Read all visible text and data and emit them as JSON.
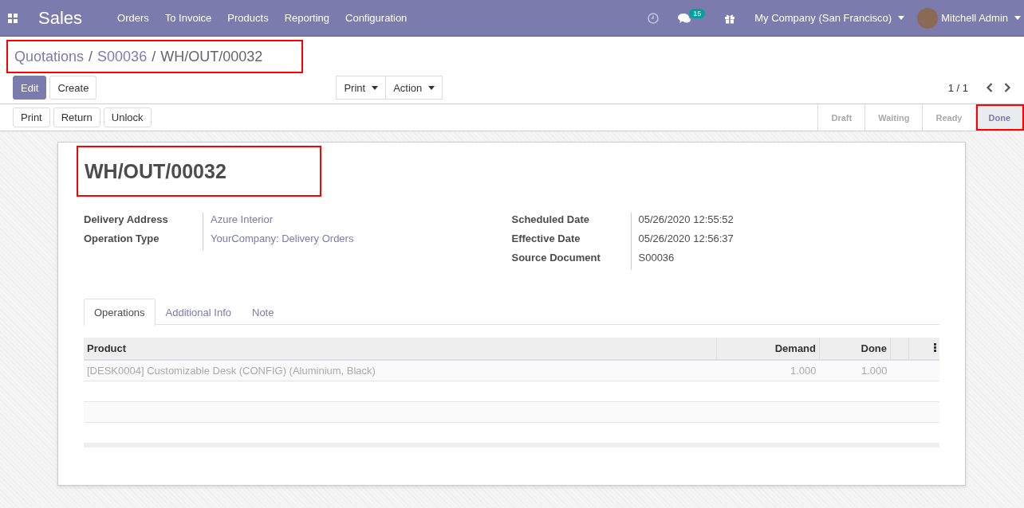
{
  "navbar": {
    "app_name": "Sales",
    "menus": [
      "Orders",
      "To Invoice",
      "Products",
      "Reporting",
      "Configuration"
    ],
    "message_count": "15",
    "company": "My Company (San Francisco)",
    "user": "Mitchell Admin"
  },
  "breadcrumb": {
    "highlighted": true,
    "items": [
      {
        "label": "Quotations",
        "link": true
      },
      {
        "separator": "/",
        "label": "S00036",
        "link": true
      },
      {
        "separator": "/",
        "label": "WH/OUT/00032",
        "link": false
      }
    ]
  },
  "control_buttons": [
    {
      "label": "Edit",
      "kind": "edit"
    },
    {
      "label": "Create",
      "kind": "create"
    }
  ],
  "dropdowns": [
    "Print",
    "Action"
  ],
  "pager": {
    "value": "1 / 1"
  },
  "header_buttons": [
    "Print",
    "Return",
    "Unlock"
  ],
  "status_steps": [
    {
      "label": "Draft",
      "selected": false,
      "highlighted": false
    },
    {
      "label": "Waiting",
      "selected": false,
      "highlighted": false
    },
    {
      "label": "Ready",
      "selected": false,
      "highlighted": false
    },
    {
      "label": "Done",
      "selected": true,
      "highlighted": true
    }
  ],
  "record": {
    "title": "WH/OUT/00032",
    "title_highlighted": true,
    "left_fields": [
      {
        "label": "Delivery Address",
        "value": "Azure Interior",
        "link": true
      },
      {
        "label": "Operation Type",
        "value": "YourCompany: Delivery Orders",
        "link": true
      }
    ],
    "right_fields": [
      {
        "label": "Scheduled Date",
        "value": "05/26/2020 12:55:52",
        "link": false
      },
      {
        "label": "Effective Date",
        "value": "05/26/2020 12:56:37",
        "link": false
      },
      {
        "label": "Source Document",
        "value": "S00036",
        "link": false
      }
    ]
  },
  "tabs": [
    {
      "label": "Operations",
      "selected": true
    },
    {
      "label": "Additional Info",
      "selected": false
    },
    {
      "label": "Note",
      "selected": false
    }
  ],
  "table": {
    "columns": [
      "Product",
      "Demand",
      "Done"
    ],
    "rows": [
      [
        "[DESK0004] Customizable Desk (CONFIG) (Aluminium, Black)",
        "1.000",
        "1.000"
      ]
    ]
  }
}
